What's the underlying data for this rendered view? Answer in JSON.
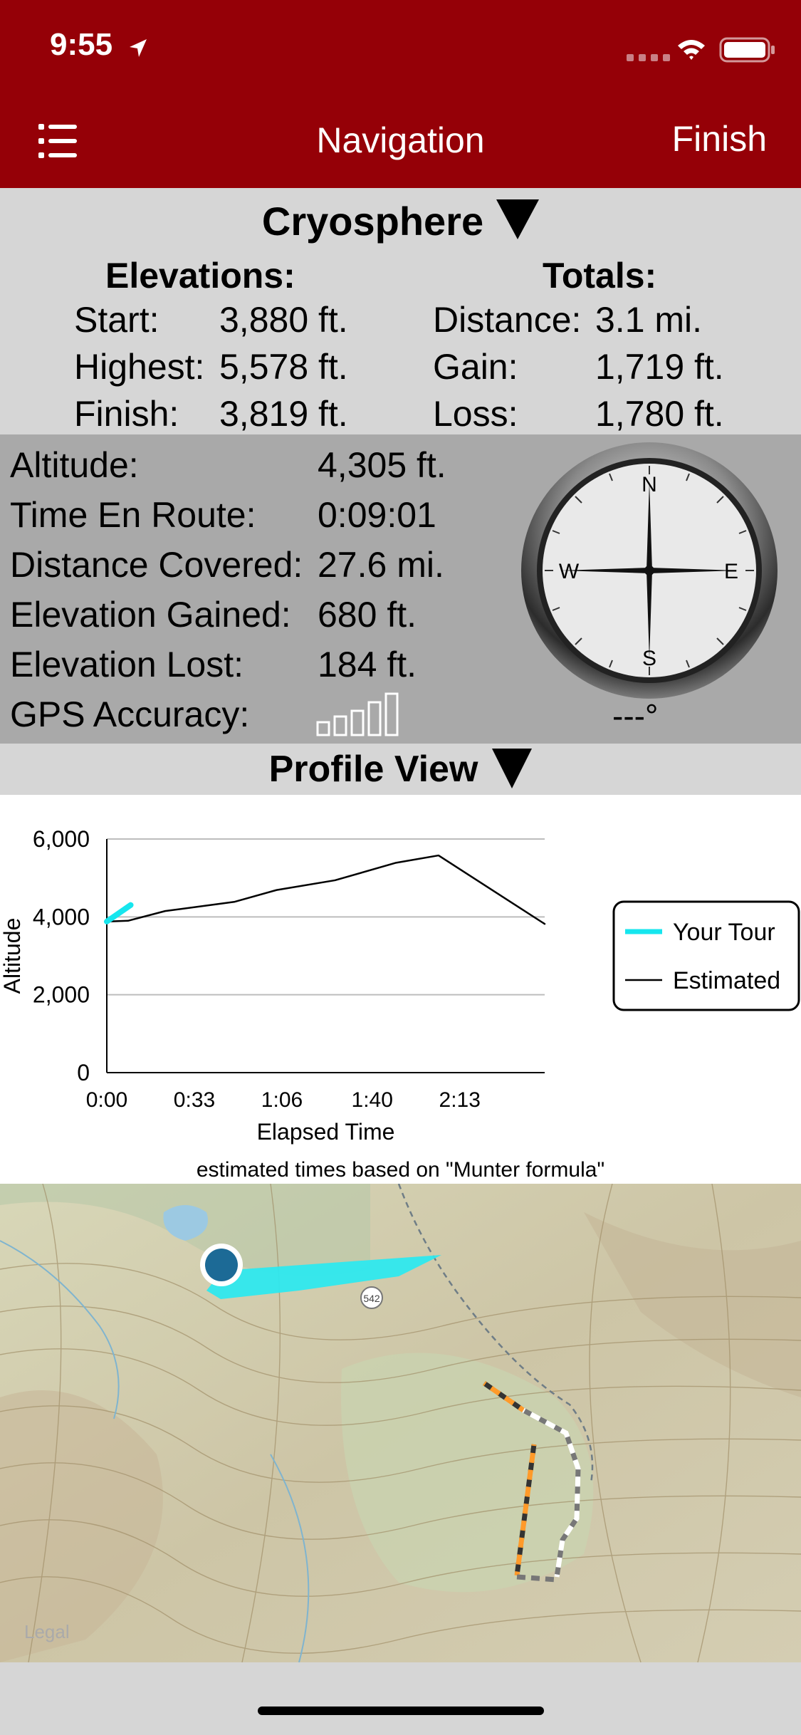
{
  "status_bar": {
    "time": "9:55"
  },
  "nav": {
    "title": "Navigation",
    "finish_label": "Finish"
  },
  "route": {
    "name": "Cryosphere",
    "elevations": {
      "header": "Elevations:",
      "rows": [
        {
          "label": "Start:",
          "value": "3,880 ft."
        },
        {
          "label": "Highest:",
          "value": "5,578 ft."
        },
        {
          "label": "Finish:",
          "value": "3,819 ft."
        }
      ]
    },
    "totals": {
      "header": "Totals:",
      "rows": [
        {
          "label": "Distance:",
          "value": "3.1 mi."
        },
        {
          "label": "Gain:",
          "value": "1,719 ft."
        },
        {
          "label": "Loss:",
          "value": "1,780 ft."
        }
      ]
    }
  },
  "live": {
    "rows": [
      {
        "label": "Altitude:",
        "value": "4,305 ft."
      },
      {
        "label": "Time En Route:",
        "value": "0:09:01"
      },
      {
        "label": "Distance Covered:",
        "value": "27.6 mi."
      },
      {
        "label": "Elevation Gained:",
        "value": "680 ft."
      },
      {
        "label": "Elevation Lost:",
        "value": "184 ft."
      }
    ],
    "gps_label": "GPS Accuracy:",
    "gps_bars_filled": 0,
    "gps_bars_total": 5,
    "heading": "---°",
    "compass_letters": {
      "n": "N",
      "e": "E",
      "s": "S",
      "w": "W"
    }
  },
  "profile": {
    "title": "Profile View",
    "munter_note": "estimated times based on \"Munter formula\""
  },
  "chart_data": {
    "type": "line",
    "xlabel": "Elapsed Time",
    "ylabel": "Altitude",
    "x_tick_labels": [
      "0:00",
      "0:33",
      "1:06",
      "1:40",
      "2:13"
    ],
    "x_tick_minutes": [
      0,
      33,
      66,
      100,
      133
    ],
    "xlim": [
      0,
      165
    ],
    "y_ticks": [
      0,
      2000,
      4000,
      6000
    ],
    "y_tick_labels": [
      "0",
      "2,000",
      "4,000",
      "6,000"
    ],
    "ylim": [
      0,
      6000
    ],
    "grid": true,
    "legend_position": "right",
    "series": [
      {
        "name": "Your Tour",
        "color": "#16e6ee",
        "x": [
          0,
          9
        ],
        "y": [
          3880,
          4305
        ]
      },
      {
        "name": "Estimated",
        "color": "#000000",
        "x": [
          0,
          8,
          22,
          48,
          64,
          86,
          109,
          125,
          165
        ],
        "y": [
          3880,
          3900,
          4150,
          4385,
          4690,
          4940,
          5390,
          5578,
          3819
        ]
      }
    ]
  },
  "map": {
    "legal_label": "Legal",
    "road_number": "542"
  },
  "colors": {
    "nav_bar": "#950007",
    "info_panel": "#d6d6d6",
    "live_panel": "#a9a9a9",
    "your_tour": "#16e6ee"
  }
}
